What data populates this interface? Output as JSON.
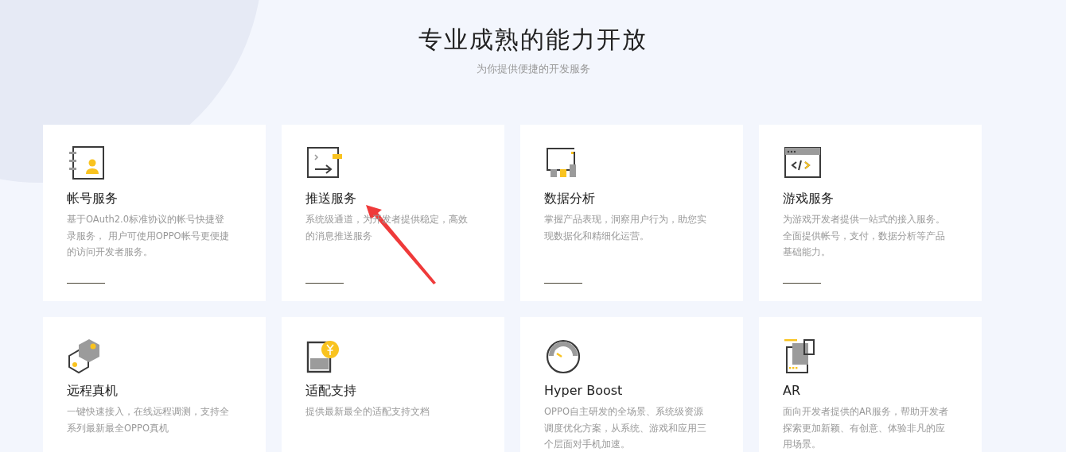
{
  "header": {
    "title": "专业成熟的能力开放",
    "subtitle": "为你提供便捷的开发服务"
  },
  "cards": [
    {
      "title": "帐号服务",
      "description": "基于OAuth2.0标准协议的帐号快捷登录服务， 用户可使用OPPO帐号更便捷的访问开发者服务。"
    },
    {
      "title": "推送服务",
      "description": "系统级通道，为开发者提供稳定，高效的消息推送服务"
    },
    {
      "title": "数据分析",
      "description": "掌握产品表现，洞察用户行为，助您实现数据化和精细化运营。"
    },
    {
      "title": "游戏服务",
      "description": "为游戏开发者提供一站式的接入服务。全面提供帐号，支付，数据分析等产品基础能力。"
    },
    {
      "title": "远程真机",
      "description": "一键快速接入，在线远程调测，支持全系列最新最全OPPO真机"
    },
    {
      "title": "适配支持",
      "description": "提供最新最全的适配支持文档"
    },
    {
      "title": "Hyper Boost",
      "description": "OPPO自主研发的全场景、系统级资源调度优化方案，从系统、游戏和应用三个层面对手机加速。"
    },
    {
      "title": "AR",
      "description": "面向开发者提供的AR服务，帮助开发者探索更加新颖、有创意、体验非凡的应用场景。"
    }
  ]
}
